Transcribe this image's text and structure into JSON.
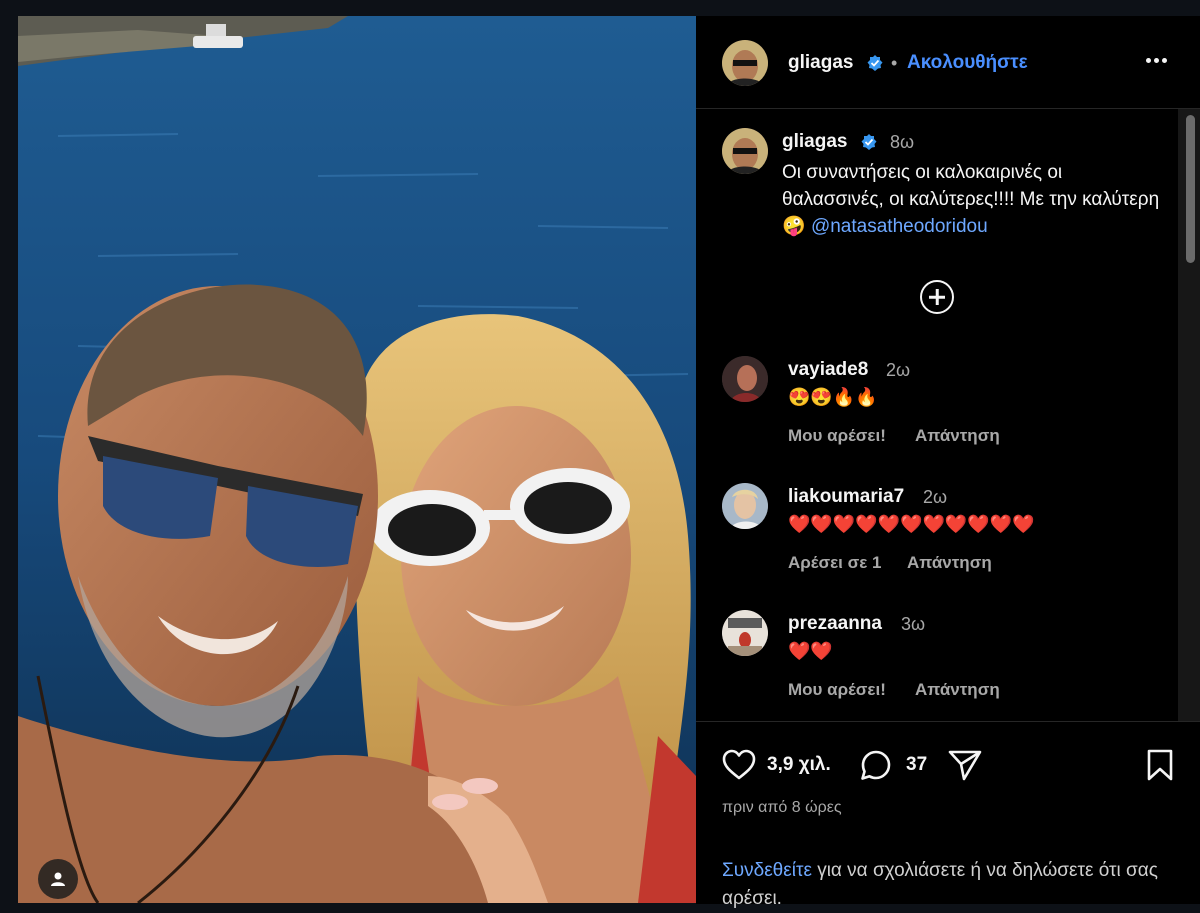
{
  "post": {
    "author": "gliagas",
    "follow_label": "Ακολουθήστε",
    "dot": "•",
    "caption_author": "gliagas",
    "caption_time": "8ω",
    "caption_text": "Οι συναντήσεις οι καλοκαιρινές οι θαλασσινές, οι καλύτερες!!!! Με την καλύτερη🤪",
    "caption_mention": "@natasatheodoridou"
  },
  "comments": [
    {
      "user": "vayiade8",
      "time": "2ω",
      "text": "😍😍🔥🔥",
      "like_label": "Μου αρέσει!",
      "reply_label": "Απάντηση"
    },
    {
      "user": "liakoumaria7",
      "time": "2ω",
      "text": "❤️❤️❤️❤️❤️❤️❤️❤️❤️❤️❤️",
      "like_label": "Αρέσει σε 1",
      "reply_label": "Απάντηση"
    },
    {
      "user": "prezaanna",
      "time": "3ω",
      "text": "❤️❤️",
      "like_label": "Μου αρέσει!",
      "reply_label": "Απάντηση"
    }
  ],
  "stats": {
    "likes": "3,9 χιλ.",
    "comments": "37",
    "posted_ago": "πριν από 8 ώρες"
  },
  "login_prompt": {
    "link": "Συνδεθείτε",
    "rest": " για να σχολιάσετε ή να δηλώσετε ότι σας αρέσει."
  },
  "colors": {
    "accent": "#4a8fff",
    "verified": "#3897f0",
    "panel_bg": "#000000"
  },
  "icons": [
    "verified-badge-icon",
    "more-options-icon",
    "add-comment-icon",
    "heart-icon",
    "comment-bubble-icon",
    "share-icon",
    "bookmark-icon",
    "user-tag-icon"
  ]
}
